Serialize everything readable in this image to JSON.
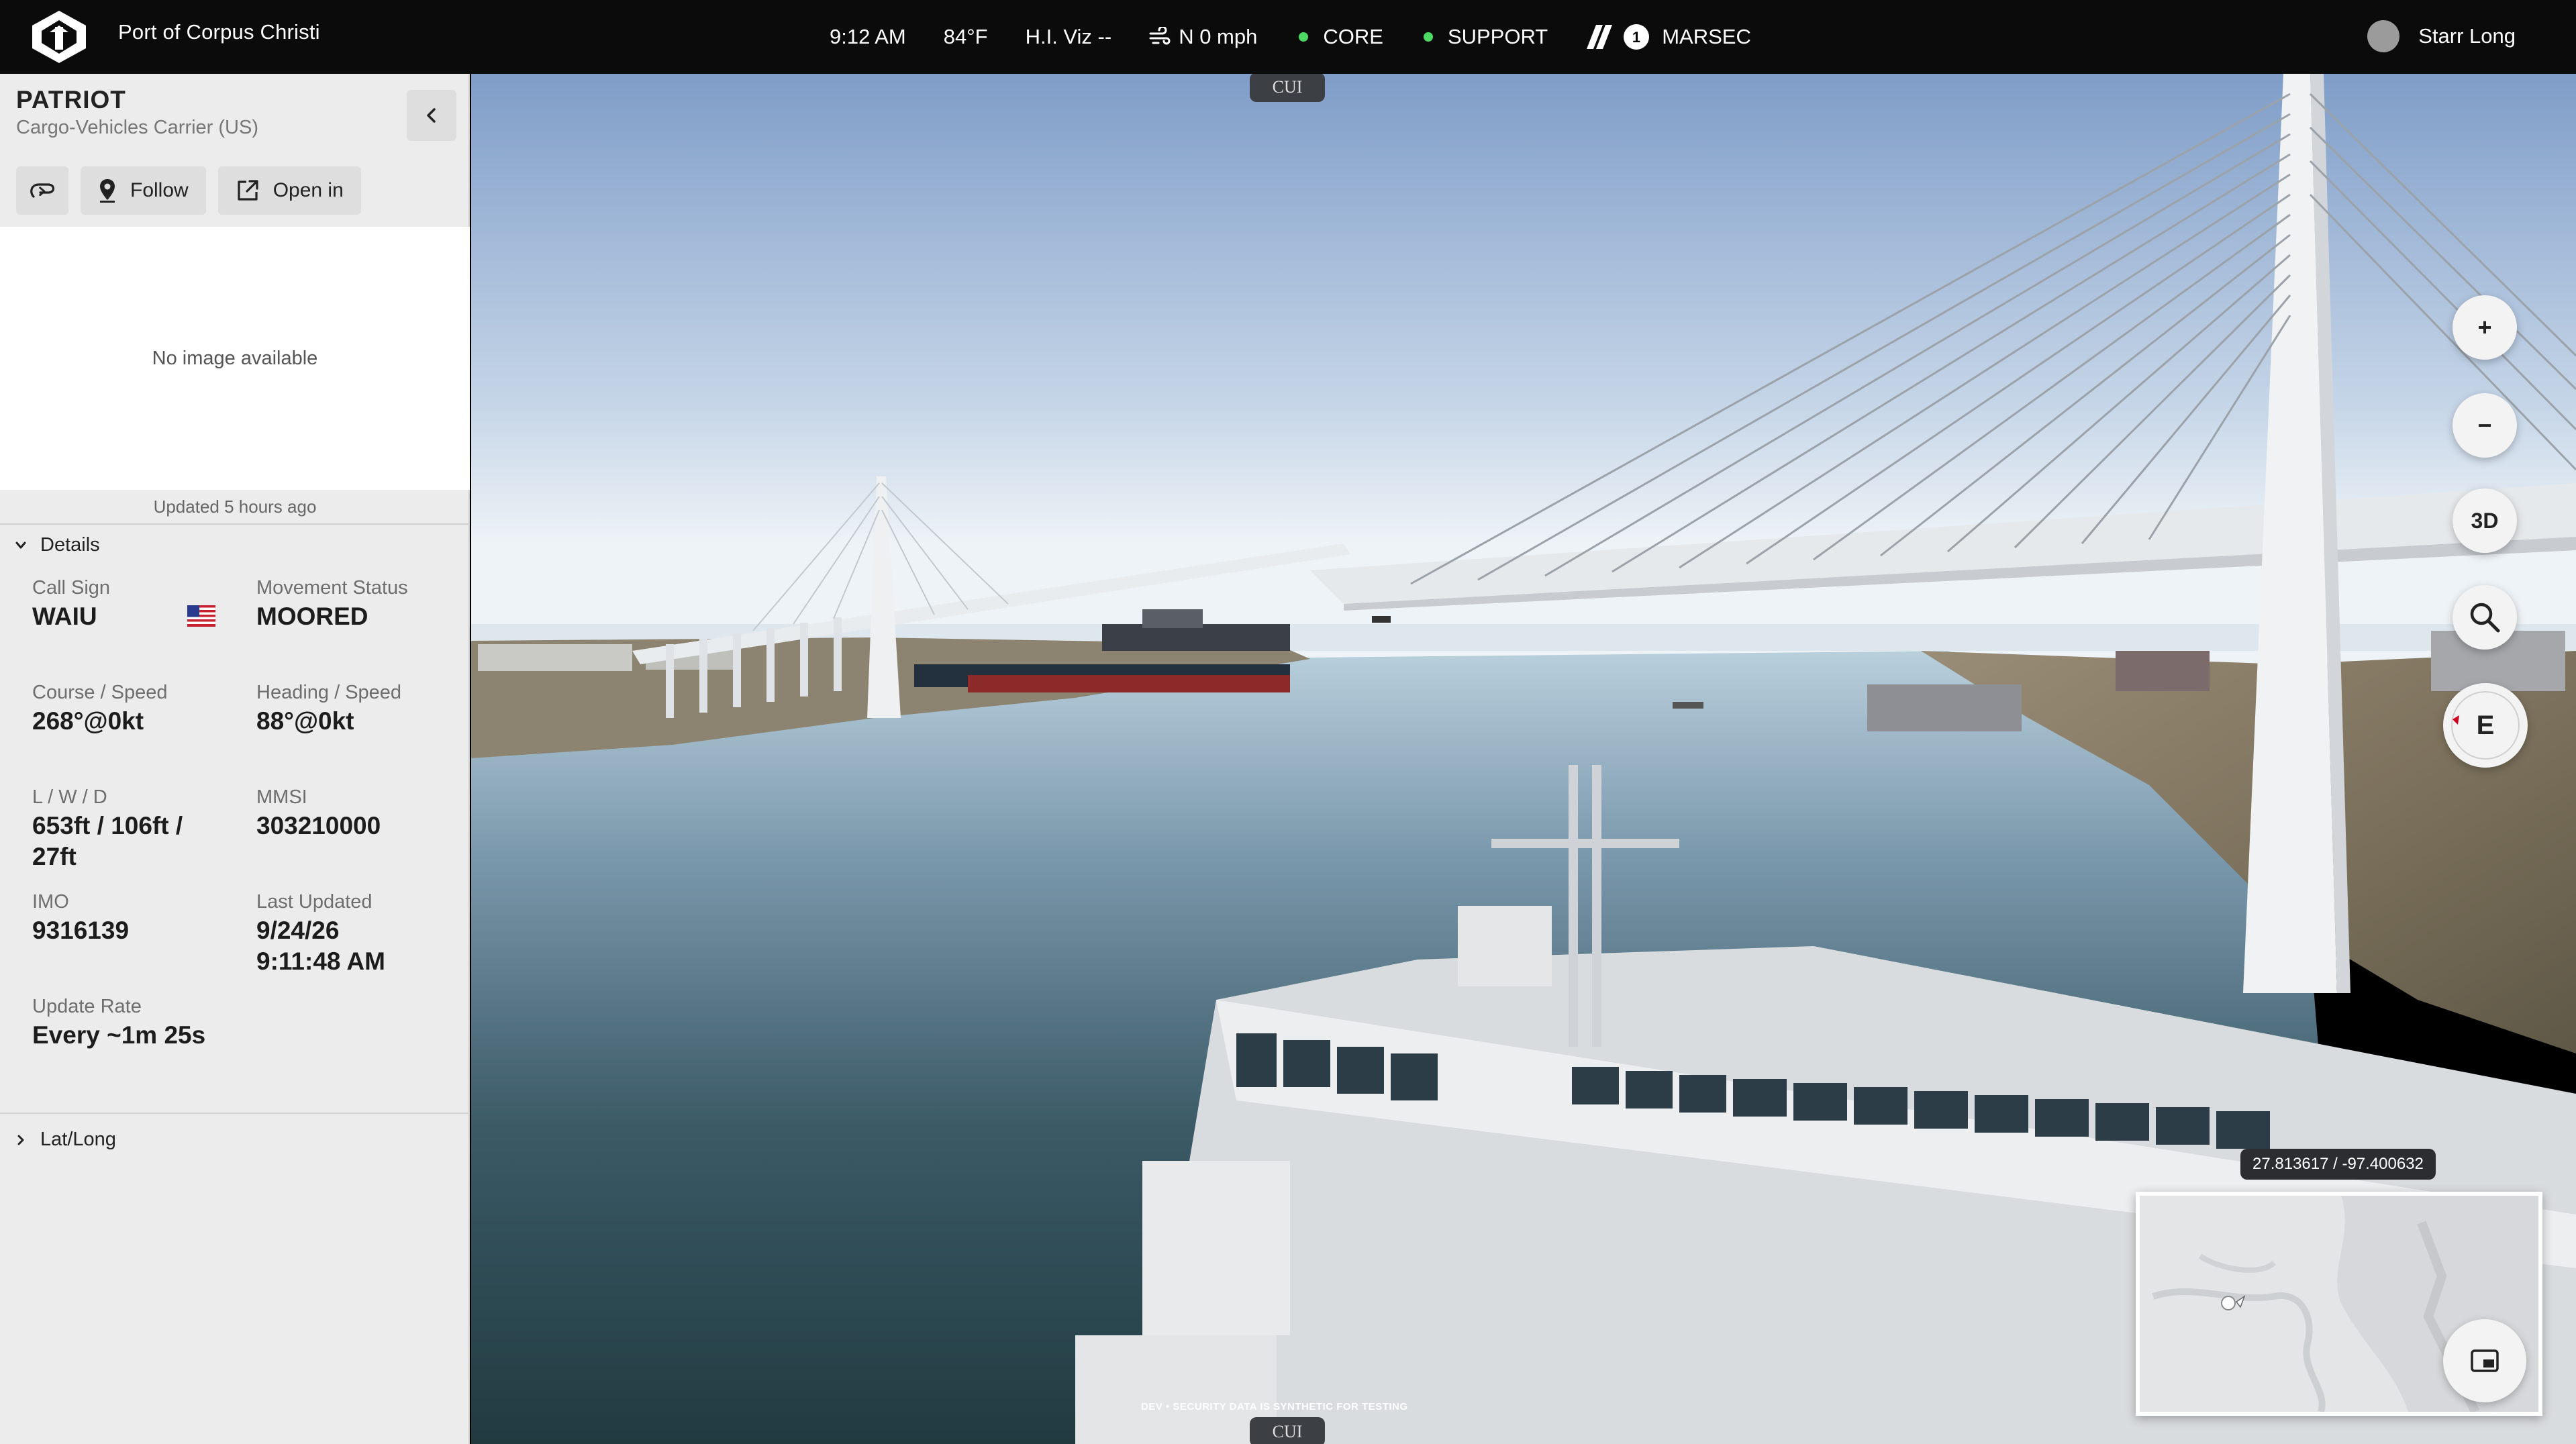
{
  "topbar": {
    "port_name": "Port of Corpus Christi",
    "time": "9:12 AM",
    "temperature": "84°F",
    "visibility": "H.I. Viz --",
    "wind": "N 0 mph",
    "core_label": "CORE",
    "support_label": "SUPPORT",
    "marsec_level": "1",
    "marsec_label": "MARSEC",
    "user_name": "Starr Long",
    "status_color": "#4cd964"
  },
  "panel": {
    "vessel_name": "PATRIOT",
    "vessel_type": "Cargo-Vehicles Carrier (US)",
    "follow_label": "Follow",
    "open_in_label": "Open in",
    "no_image_text": "No image available",
    "updated_text": "Updated 5 hours ago",
    "details_label": "Details",
    "latlong_label": "Lat/Long",
    "fields": {
      "call_sign_label": "Call Sign",
      "call_sign": "WAIU",
      "movement_label": "Movement Status",
      "movement": "MOORED",
      "course_label": "Course / Speed",
      "course": "268°@0kt",
      "heading_label": "Heading / Speed",
      "heading": "88°@0kt",
      "lwd_label": "L / W / D",
      "lwd_line1": "653ft / 106ft /",
      "lwd_line2": "27ft",
      "mmsi_label": "MMSI",
      "mmsi": "303210000",
      "imo_label": "IMO",
      "imo": "9316139",
      "last_updated_label": "Last Updated",
      "last_updated_date": "9/24/26",
      "last_updated_time": "9:11:48 AM",
      "update_rate_label": "Update Rate",
      "update_rate": "Every ~1m 25s"
    }
  },
  "viewport": {
    "cui_label": "CUI",
    "zoom_in": "+",
    "zoom_out": "−",
    "view_mode": "3D",
    "compass_heading": "E",
    "coordinates": "27.813617 / -97.400632",
    "dev_notice": "DEV • SECURITY DATA IS SYNTHETIC FOR TESTING"
  }
}
